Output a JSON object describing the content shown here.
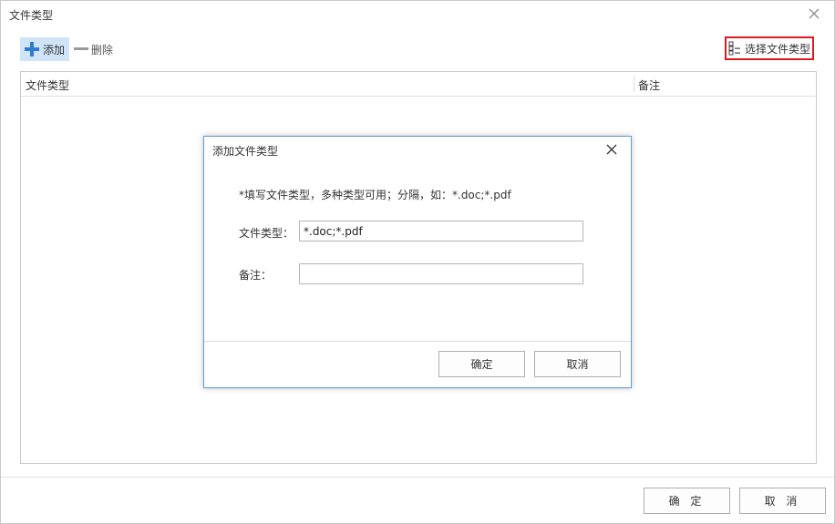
{
  "window": {
    "title": "文件类型"
  },
  "toolbar": {
    "add_label": "添加",
    "delete_label": "删除",
    "select_type_label": "选择文件类型"
  },
  "grid": {
    "columns": [
      "文件类型",
      "备注"
    ],
    "rows": []
  },
  "footer": {
    "ok_label": "确 定",
    "cancel_label": "取 消"
  },
  "dialog": {
    "title": "添加文件类型",
    "hint": "*填写文件类型，多种类型可用；分隔，如：*.doc;*.pdf",
    "type_label": "文件类型：",
    "type_value": "*.doc;*.pdf",
    "note_label": "备注：",
    "note_value": "",
    "ok_label": "确定",
    "cancel_label": "取消"
  },
  "colors": {
    "accent": "#2e7bd1",
    "highlight_border": "#e0191f",
    "add_bg": "#cfe5f7",
    "dialog_border": "#5b9bd5"
  }
}
